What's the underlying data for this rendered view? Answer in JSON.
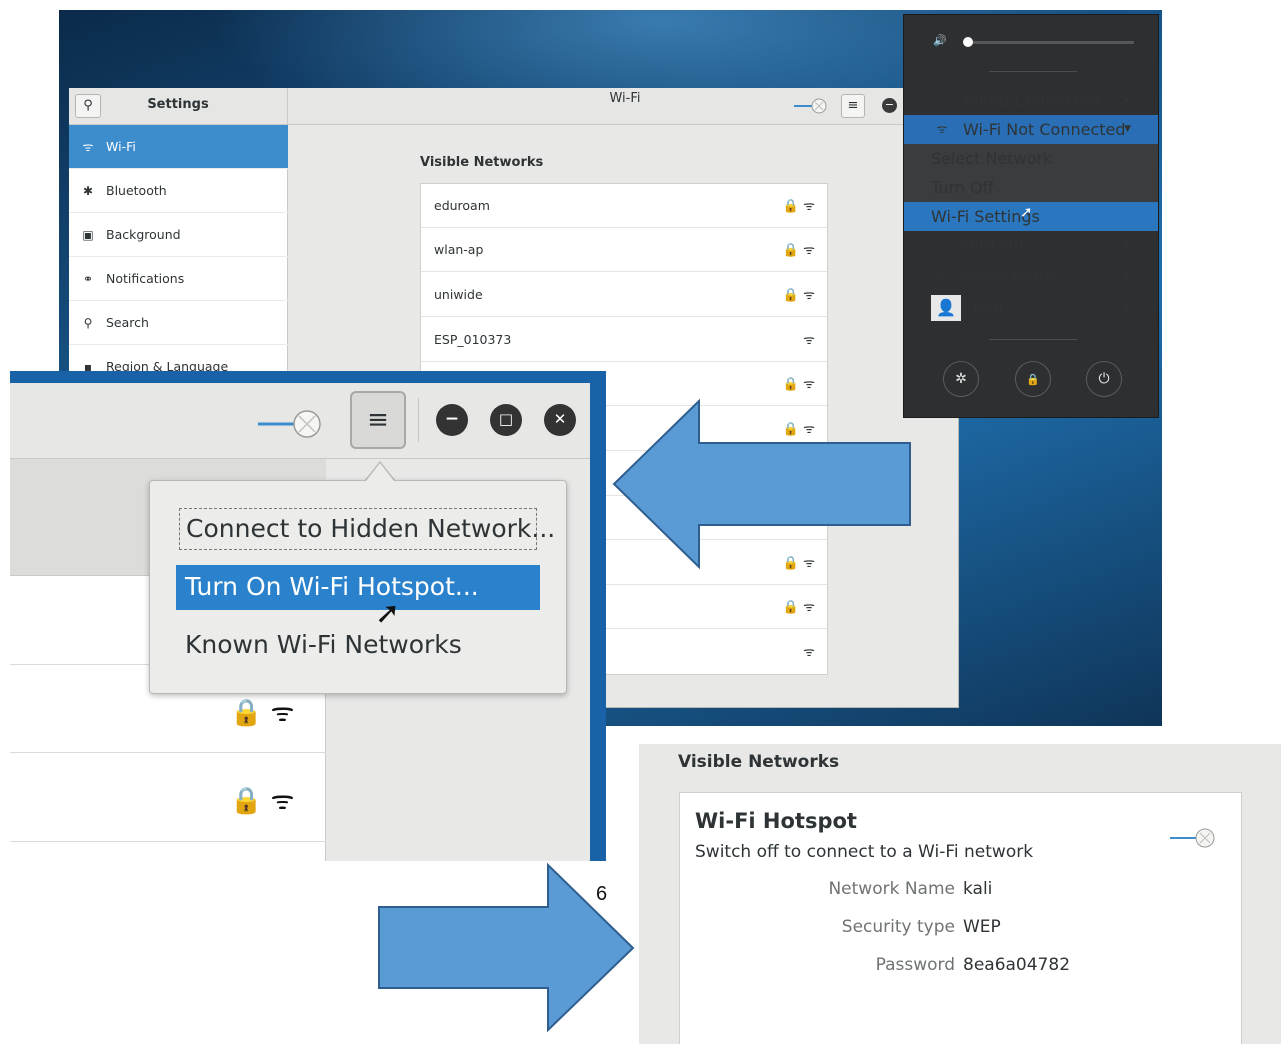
{
  "colors": {
    "accent": "#3d8ccc",
    "desktop": "#1b5f96",
    "arrow": "#5b9bd5",
    "arrow_border": "#2e5e8e",
    "menu_bg": "#2d2f30"
  },
  "settings": {
    "title": "Settings",
    "panel_title": "Wi-Fi",
    "sidebar": [
      {
        "label": "Wi-Fi",
        "icon": "wifi-icon",
        "glyph": "ᯤ"
      },
      {
        "label": "Bluetooth",
        "icon": "bluetooth-icon",
        "glyph": "✱"
      },
      {
        "label": "Background",
        "icon": "background-icon",
        "glyph": "▣"
      },
      {
        "label": "Notifications",
        "icon": "notifications-icon",
        "glyph": "⚭"
      },
      {
        "label": "Search",
        "icon": "search-icon",
        "glyph": "⚲"
      },
      {
        "label": "Region & Language",
        "icon": "region-icon",
        "glyph": "▪"
      }
    ],
    "visible_networks_title": "Visible Networks",
    "networks": [
      {
        "name": "eduroam",
        "icons": "🔒 ᯤ"
      },
      {
        "name": "wlan-ap",
        "icons": "🔒 ᯤ"
      },
      {
        "name": "uniwide",
        "icons": "🔒 ᯤ"
      },
      {
        "name": "ESP_010373",
        "icons": "ᯤ"
      },
      {
        "name": "",
        "icons": "🔒 ᯤ"
      },
      {
        "name": "",
        "icons": "🔒 ᯤ"
      },
      {
        "name": "",
        "icons": ""
      },
      {
        "name": "",
        "icons": ""
      },
      {
        "name": "",
        "icons": "🔒 ᯤ"
      },
      {
        "name": "",
        "icons": "🔒 ᯤ"
      },
      {
        "name": "",
        "icons": "ᯤ"
      }
    ]
  },
  "system_menu": {
    "volume": 0.02,
    "items": [
      {
        "label": "Wired Connected",
        "icon": "wired-icon",
        "glyph": "✐",
        "arrow": "▶"
      },
      {
        "label": "Wi-Fi Not Connected",
        "icon": "wifi-icon",
        "glyph": "ᯤ",
        "arrow": "▼"
      },
      {
        "label": "Select Network"
      },
      {
        "label": "Turn Off"
      },
      {
        "label": "Wi-Fi Settings"
      },
      {
        "label": "VPN Off",
        "icon": "vpn-icon",
        "glyph": "✐",
        "arrow": "▶"
      },
      {
        "label": "Proxy None",
        "icon": "proxy-icon",
        "glyph": "⚙",
        "arrow": "▶"
      },
      {
        "label": "root",
        "icon": "user-icon",
        "glyph": "👤",
        "arrow": "▶"
      }
    ],
    "buttons": [
      {
        "name": "settings-icon",
        "glyph": "✲"
      },
      {
        "name": "lock-icon",
        "glyph": "🔒"
      },
      {
        "name": "power-icon",
        "glyph": "⏻"
      }
    ]
  },
  "zoom": {
    "menu_glyph": "≡",
    "window_buttons": [
      "−",
      "□",
      "✕"
    ],
    "popover": {
      "connect_hidden": "Connect to Hidden Network...",
      "turn_on_hotspot": "Turn On Wi-Fi Hotspot...",
      "known_networks": "Known Wi-Fi Networks"
    },
    "row_icons": "🔒 ᯤ"
  },
  "step_number": "6",
  "hotspot": {
    "section_title": "Visible Networks",
    "title": "Wi-Fi Hotspot",
    "subtitle": "Switch off to connect to a Wi-Fi network",
    "fields": [
      {
        "key": "Network Name",
        "value": "kali"
      },
      {
        "key": "Security type",
        "value": "WEP"
      },
      {
        "key": "Password",
        "value": "8ea6a04782"
      }
    ]
  }
}
